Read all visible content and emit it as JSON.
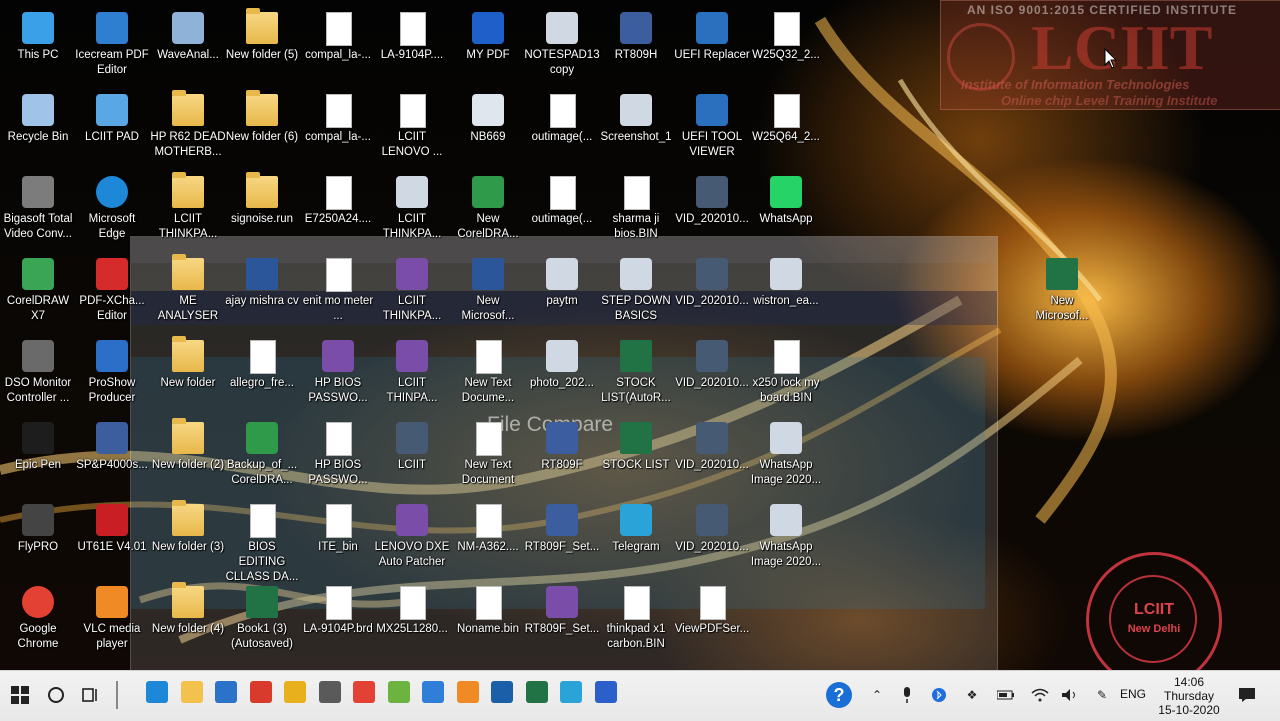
{
  "wallpaper": {
    "ghost_title": "File Compare",
    "brand": {
      "top_line": "AN ISO 9001:2015 CERTIFIED INSTITUTE",
      "word": "LCIIT",
      "sub1": "Institute of Information Technologies",
      "sub2": "Online chip Level Training Institute"
    },
    "stamp": {
      "line1": "LCIIT",
      "line2": "New Delhi"
    }
  },
  "desktop": {
    "icons": [
      {
        "label": "This PC",
        "icon": "this-pc-icon"
      },
      {
        "label": "Icecream PDF Editor",
        "icon": "pdf-editor-icon"
      },
      {
        "label": "WaveAnal...",
        "icon": "wave-analyzer-icon"
      },
      {
        "label": "New folder (5)",
        "icon": "folder-icon"
      },
      {
        "label": "compal_la-...",
        "icon": "document-icon"
      },
      {
        "label": "LA-9104P....",
        "icon": "file-icon"
      },
      {
        "label": "MY PDF",
        "icon": "pdf-app-icon"
      },
      {
        "label": "NOTESPAD13 copy",
        "icon": "image-file-icon"
      },
      {
        "label": "RT809H",
        "icon": "programmer-icon"
      },
      {
        "label": "UEFI Replacer",
        "icon": "uefi-icon"
      },
      {
        "label": "W25Q32_2...",
        "icon": "file-icon"
      },
      {
        "label": "Recycle Bin",
        "icon": "recycle-bin-icon"
      },
      {
        "label": "LCIIT PAD",
        "icon": "notepad-icon"
      },
      {
        "label": "HP R62 DEAD MOTHERB...",
        "icon": "folder-zip-icon"
      },
      {
        "label": "New folder (6)",
        "icon": "folder-icon"
      },
      {
        "label": "compal_la-...",
        "icon": "document-icon"
      },
      {
        "label": "LCIIT LENOVO ...",
        "icon": "file-icon"
      },
      {
        "label": "NB669",
        "icon": "datasheet-icon"
      },
      {
        "label": "outimage(...",
        "icon": "file-icon"
      },
      {
        "label": "Screenshot_1",
        "icon": "image-file-icon"
      },
      {
        "label": "UEFI TOOL VIEWER",
        "icon": "uefi-icon"
      },
      {
        "label": "W25Q64_2...",
        "icon": "file-icon"
      },
      {
        "label": "Bigasoft Total Video Conv...",
        "icon": "video-converter-icon"
      },
      {
        "label": "Microsoft Edge",
        "icon": "edge-icon"
      },
      {
        "label": "LCIIT THINKPA...",
        "icon": "folder-zip-icon"
      },
      {
        "label": "signoise.run",
        "icon": "folder-icon"
      },
      {
        "label": "E7250A24....",
        "icon": "file-icon"
      },
      {
        "label": "LCIIT THINKPA...",
        "icon": "image-file-icon"
      },
      {
        "label": "New CorelDRA...",
        "icon": "corel-file-icon"
      },
      {
        "label": "outimage(...",
        "icon": "file-icon"
      },
      {
        "label": "sharma ji bios.BIN",
        "icon": "file-icon"
      },
      {
        "label": "VID_202010...",
        "icon": "video-file-icon"
      },
      {
        "label": "WhatsApp",
        "icon": "whatsapp-icon"
      },
      {
        "label": "CorelDRAW X7",
        "icon": "coreldraw-icon"
      },
      {
        "label": "PDF-XCha... Editor",
        "icon": "pdf-xchange-icon"
      },
      {
        "label": "ME ANALYSER",
        "icon": "folder-zip-icon"
      },
      {
        "label": "ajay mishra cv",
        "icon": "word-doc-icon"
      },
      {
        "label": "enit mo meter ...",
        "icon": "file-icon"
      },
      {
        "label": "LCIIT THINKPA...",
        "icon": "winrar-icon"
      },
      {
        "label": "New Microsof...",
        "icon": "word-doc-icon"
      },
      {
        "label": "paytm",
        "icon": "image-file-icon"
      },
      {
        "label": "STEP DOWN BASICS",
        "icon": "image-file-icon"
      },
      {
        "label": "VID_202010...",
        "icon": "video-file-icon"
      },
      {
        "label": "wistron_ea...",
        "icon": "image-file-icon"
      },
      {
        "label": "New Microsof...",
        "icon": "excel-doc-icon"
      },
      {
        "label": "DSO Monitor Controller ...",
        "icon": "dso-monitor-icon"
      },
      {
        "label": "ProShow Producer",
        "icon": "proshow-icon"
      },
      {
        "label": "New folder",
        "icon": "folder-icon"
      },
      {
        "label": "allegro_fre...",
        "icon": "file-icon"
      },
      {
        "label": "HP BIOS PASSWO...",
        "icon": "winrar-icon"
      },
      {
        "label": "LCIIT THINPA...",
        "icon": "winrar-icon"
      },
      {
        "label": "New Text Docume...",
        "icon": "file-icon"
      },
      {
        "label": "photo_202...",
        "icon": "image-file-icon"
      },
      {
        "label": "STOCK LIST(AutoR...",
        "icon": "excel-doc-icon"
      },
      {
        "label": "VID_202010...",
        "icon": "video-file-icon"
      },
      {
        "label": "x250 lock my board.BIN",
        "icon": "file-icon"
      },
      {
        "label": "Epic Pen",
        "icon": "epic-pen-icon"
      },
      {
        "label": "SP&P4000s...",
        "icon": "programmer-icon"
      },
      {
        "label": "New folder (2)",
        "icon": "folder-icon"
      },
      {
        "label": "Backup_of_... CorelDRA...",
        "icon": "corel-file-icon"
      },
      {
        "label": "HP BIOS PASSWO...",
        "icon": "file-icon"
      },
      {
        "label": "LCIIT",
        "icon": "video-file-icon"
      },
      {
        "label": "New Text Document",
        "icon": "file-icon"
      },
      {
        "label": "RT809F",
        "icon": "programmer-icon"
      },
      {
        "label": "STOCK LIST",
        "icon": "excel-doc-icon"
      },
      {
        "label": "VID_202010...",
        "icon": "video-file-icon"
      },
      {
        "label": "WhatsApp Image 2020...",
        "icon": "image-file-icon"
      },
      {
        "label": "FlyPRO",
        "icon": "flypro-icon"
      },
      {
        "label": "UT61E V4.01",
        "icon": "uni-t-icon"
      },
      {
        "label": "New folder (3)",
        "icon": "folder-icon"
      },
      {
        "label": "BIOS EDITING CLLASS DA...",
        "icon": "file-icon"
      },
      {
        "label": "ITE_bin",
        "icon": "file-icon"
      },
      {
        "label": "LENOVO DXE Auto Patcher",
        "icon": "winrar-icon"
      },
      {
        "label": "NM-A362....",
        "icon": "file-icon"
      },
      {
        "label": "RT809F_Set...",
        "icon": "programmer-icon"
      },
      {
        "label": "Telegram",
        "icon": "telegram-icon"
      },
      {
        "label": "VID_202010...",
        "icon": "video-file-icon"
      },
      {
        "label": "WhatsApp Image 2020...",
        "icon": "image-file-icon"
      },
      {
        "label": "Google Chrome",
        "icon": "chrome-icon"
      },
      {
        "label": "VLC media player",
        "icon": "vlc-icon"
      },
      {
        "label": "New folder (4)",
        "icon": "folder-icon"
      },
      {
        "label": "Book1 (3) (Autosaved)",
        "icon": "excel-doc-icon"
      },
      {
        "label": "LA-9104P.brd",
        "icon": "file-icon"
      },
      {
        "label": "MX25L1280...",
        "icon": "file-icon"
      },
      {
        "label": "Noname.bin",
        "icon": "file-icon"
      },
      {
        "label": "RT809F_Set...",
        "icon": "winrar-icon"
      },
      {
        "label": "thinkpad x1 carbon.BIN",
        "icon": "file-icon"
      },
      {
        "label": "ViewPDFSer...",
        "icon": "file-icon"
      }
    ]
  },
  "taskbar": {
    "apps": [
      {
        "name": "edge",
        "icon": "edge-icon",
        "color": "#1e88d8"
      },
      {
        "name": "file-explorer",
        "icon": "folder-icon",
        "color": "#f2c14e"
      },
      {
        "name": "mail",
        "icon": "mail-icon",
        "color": "#2b73c9"
      },
      {
        "name": "pdf",
        "icon": "pdf-icon",
        "color": "#d83b2b"
      },
      {
        "name": "app-yellow",
        "icon": "app-icon",
        "color": "#e8b01c"
      },
      {
        "name": "app-tool",
        "icon": "tool-icon",
        "color": "#5a5a5a"
      },
      {
        "name": "chrome",
        "icon": "chrome-icon",
        "color": "#e34133"
      },
      {
        "name": "app-green",
        "icon": "app-icon",
        "color": "#6db33f"
      },
      {
        "name": "app-blue",
        "icon": "app-icon",
        "color": "#2f7ed8"
      },
      {
        "name": "app-orange",
        "icon": "app-icon",
        "color": "#f08a24"
      },
      {
        "name": "photos",
        "icon": "photos-icon",
        "color": "#1b5fa8"
      },
      {
        "name": "excel",
        "icon": "excel-icon",
        "color": "#217346"
      },
      {
        "name": "telegram",
        "icon": "telegram-icon",
        "color": "#2aa3d9"
      },
      {
        "name": "app-h",
        "icon": "app-icon",
        "color": "#2b5fc9"
      }
    ],
    "language": "ENG",
    "clock": {
      "time": "14:06",
      "day": "Thursday",
      "date": "15-10-2020"
    }
  }
}
